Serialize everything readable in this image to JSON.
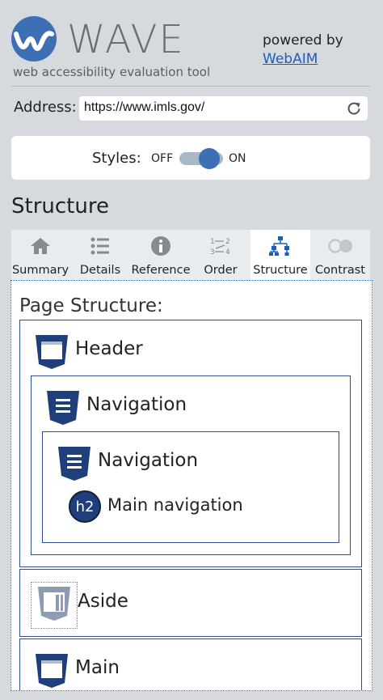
{
  "brand": {
    "name": "WAVE",
    "tagline": "web accessibility evaluation tool",
    "powered_by": "powered by",
    "powered_link": "WebAIM"
  },
  "address": {
    "label": "Address:",
    "value": "https://www.imls.gov/"
  },
  "styles": {
    "label": "Styles:",
    "off_label": "OFF",
    "on_label": "ON",
    "state": "on"
  },
  "section_title": "Structure",
  "tabs": [
    {
      "label": "Summary",
      "icon": "home-icon"
    },
    {
      "label": "Details",
      "icon": "list-icon"
    },
    {
      "label": "Reference",
      "icon": "info-icon"
    },
    {
      "label": "Order",
      "icon": "order-icon"
    },
    {
      "label": "Structure",
      "icon": "structure-icon",
      "active": true
    },
    {
      "label": "Contrast",
      "icon": "contrast-icon"
    }
  ],
  "structure": {
    "title": "Page Structure:",
    "header": "Header",
    "nav_outer": "Navigation",
    "nav_inner": "Navigation",
    "h2_badge": "h2",
    "h2_text": "Main navigation",
    "aside": "Aside",
    "main": "Main"
  },
  "colors": {
    "brand_blue": "#3d6fb5",
    "landmark_navy": "#1e3f7a",
    "panel_border": "#2c4f8f"
  }
}
